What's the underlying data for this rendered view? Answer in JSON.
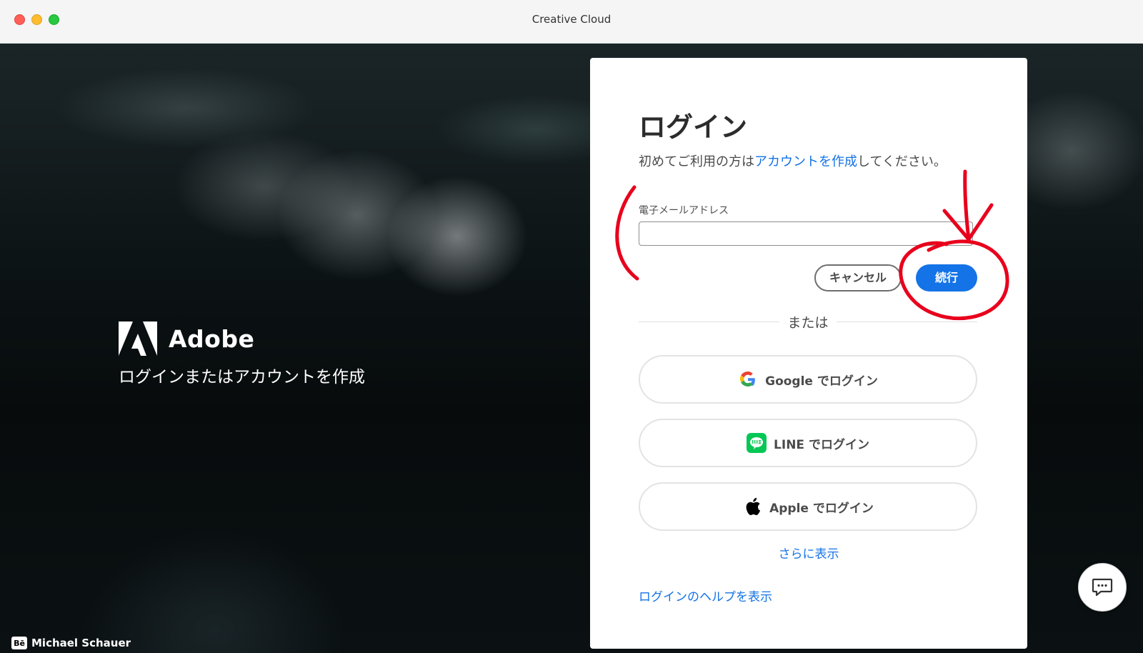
{
  "window": {
    "title": "Creative Cloud"
  },
  "brand": {
    "name": "Adobe",
    "subtitle": "ログインまたはアカウントを作成"
  },
  "credit": {
    "badge": "Bē",
    "photographer": "Michael Schauer"
  },
  "login": {
    "heading": "ログイン",
    "intro_prefix": "初めてご利用の方は",
    "intro_link": "アカウントを作成",
    "intro_suffix": "してください。",
    "email_label": "電子メールアドレス",
    "email_value": "",
    "cancel_label": "キャンセル",
    "continue_label": "続行",
    "divider_text": "または",
    "social": [
      {
        "brand": "Google",
        "suffix": " でログイン",
        "icon": "google-icon"
      },
      {
        "brand": "LINE",
        "suffix": " でログイン",
        "icon": "line-icon"
      },
      {
        "brand": "Apple",
        "suffix": " でログイン",
        "icon": "apple-icon"
      }
    ],
    "more_label": "さらに表示",
    "help_label": "ログインのヘルプを表示"
  },
  "colors": {
    "accent": "#1473e6",
    "annotation": "#e8001c",
    "line_green": "#06c755"
  },
  "chat": {
    "icon": "chat-icon"
  }
}
